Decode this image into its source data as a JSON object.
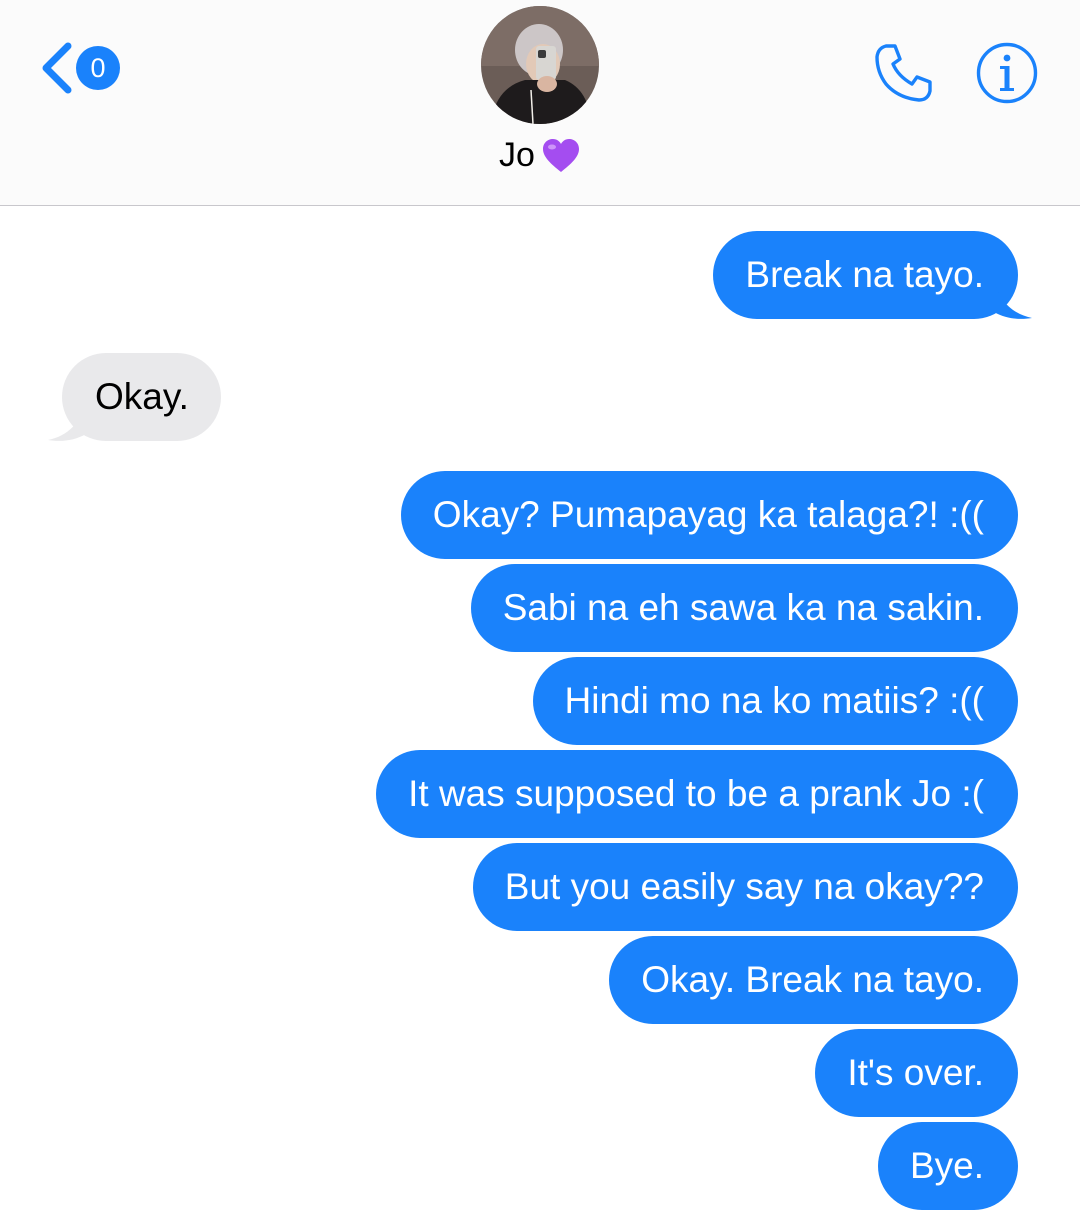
{
  "header": {
    "back_badge_count": "0",
    "contact_name": "Jo",
    "name_emoji": "purple-heart"
  },
  "colors": {
    "accent": "#1a82fb",
    "outgoing_bubble": "#1a82fb",
    "incoming_bubble": "#e9e9eb",
    "heart": "#a44df0"
  },
  "icons": {
    "back": "chevron-left-icon",
    "call": "phone-icon",
    "info": "info-icon"
  },
  "messages": [
    {
      "text": "Break na tayo.",
      "direction": "out"
    },
    {
      "text": "Okay.",
      "direction": "in"
    },
    {
      "text": "Okay? Pumapayag ka talaga?! :((",
      "direction": "out"
    },
    {
      "text": "Sabi na eh sawa ka na sakin.",
      "direction": "out"
    },
    {
      "text": "Hindi mo na ko matiis? :((",
      "direction": "out"
    },
    {
      "text": "It was supposed to be a prank Jo :(",
      "direction": "out"
    },
    {
      "text": "But you easily say na okay??",
      "direction": "out"
    },
    {
      "text": "Okay. Break na tayo.",
      "direction": "out"
    },
    {
      "text": "It's over.",
      "direction": "out"
    },
    {
      "text": "Bye.",
      "direction": "out"
    }
  ]
}
